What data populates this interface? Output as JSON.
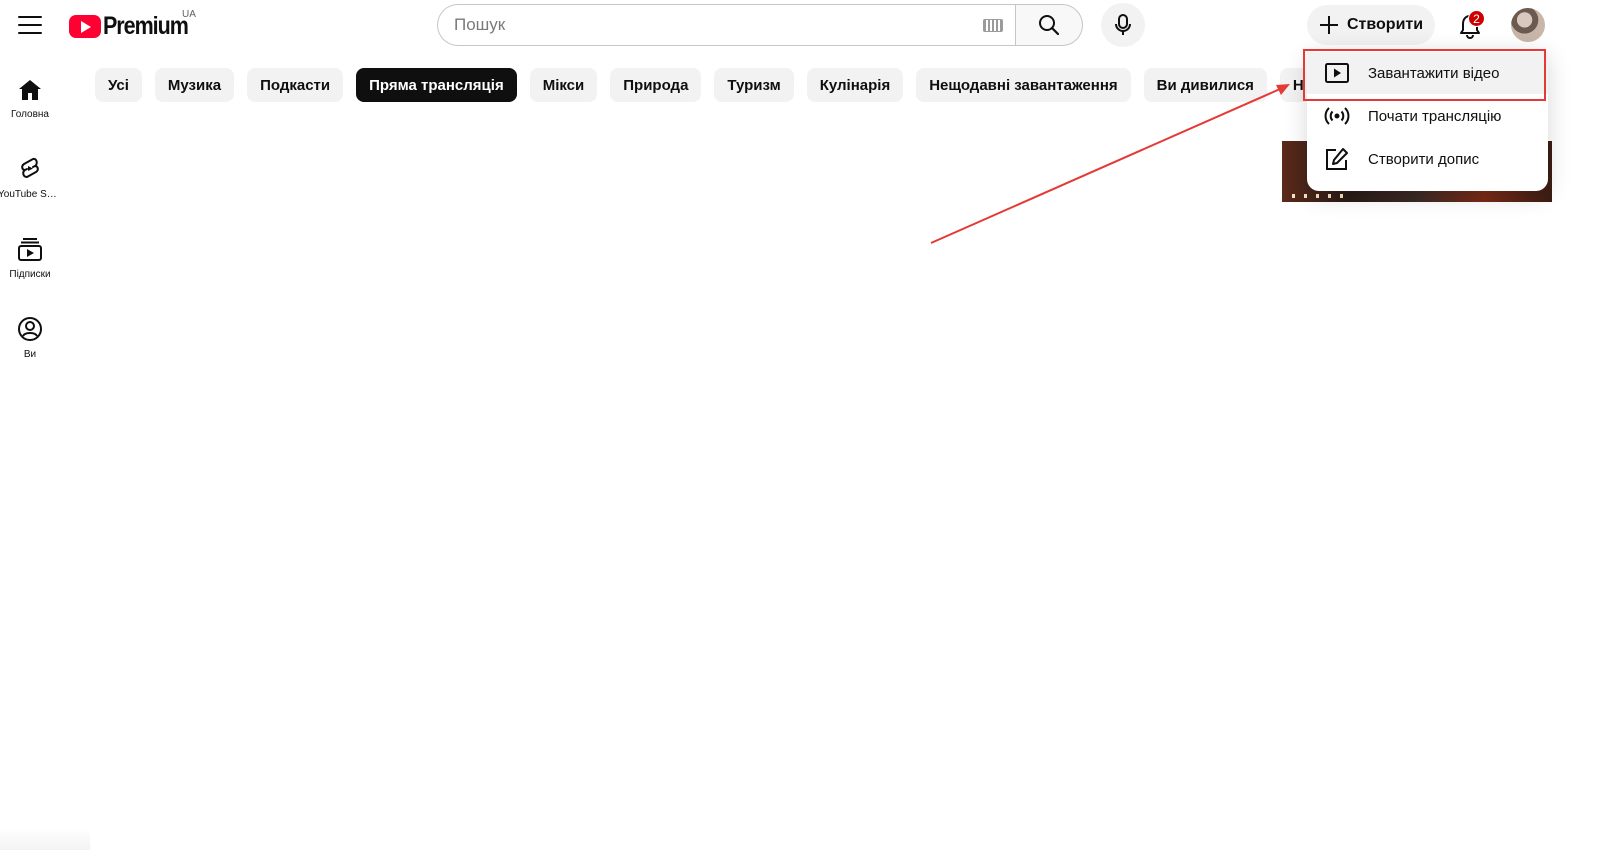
{
  "header": {
    "logo_text": "Premium",
    "country_code": "UA",
    "search_placeholder": "Пошук",
    "create_label": "Створити",
    "notification_count": "2"
  },
  "guide": {
    "items": [
      {
        "label": "Головна",
        "icon": "home-icon"
      },
      {
        "label": "YouTube Shorts",
        "icon": "shorts-icon"
      },
      {
        "label": "Підписки",
        "icon": "subscriptions-icon"
      },
      {
        "label": "Ви",
        "icon": "you-icon"
      }
    ]
  },
  "chips": [
    {
      "label": "Усі"
    },
    {
      "label": "Музика"
    },
    {
      "label": "Подкасти"
    },
    {
      "label": "Пряма трансляція",
      "active": true
    },
    {
      "label": "Мікси"
    },
    {
      "label": "Природа"
    },
    {
      "label": "Туризм"
    },
    {
      "label": "Кулінарія"
    },
    {
      "label": "Нещодавні завантаження"
    },
    {
      "label": "Ви дивилися"
    },
    {
      "label": "Нови"
    }
  ],
  "create_menu": {
    "items": [
      {
        "label": "Завантажити відео",
        "icon": "upload-video-icon"
      },
      {
        "label": "Почати трансляцію",
        "icon": "broadcast-icon"
      },
      {
        "label": "Створити допис",
        "icon": "edit-post-icon"
      }
    ]
  },
  "annotation": {
    "highlight_color": "#e53935",
    "arrow_color": "#e53935"
  },
  "colors": {
    "brand_red": "#ff0033",
    "chip_active_bg": "#0f0f0f",
    "chip_bg": "#f2f2f2",
    "badge_red": "#cc0000"
  }
}
